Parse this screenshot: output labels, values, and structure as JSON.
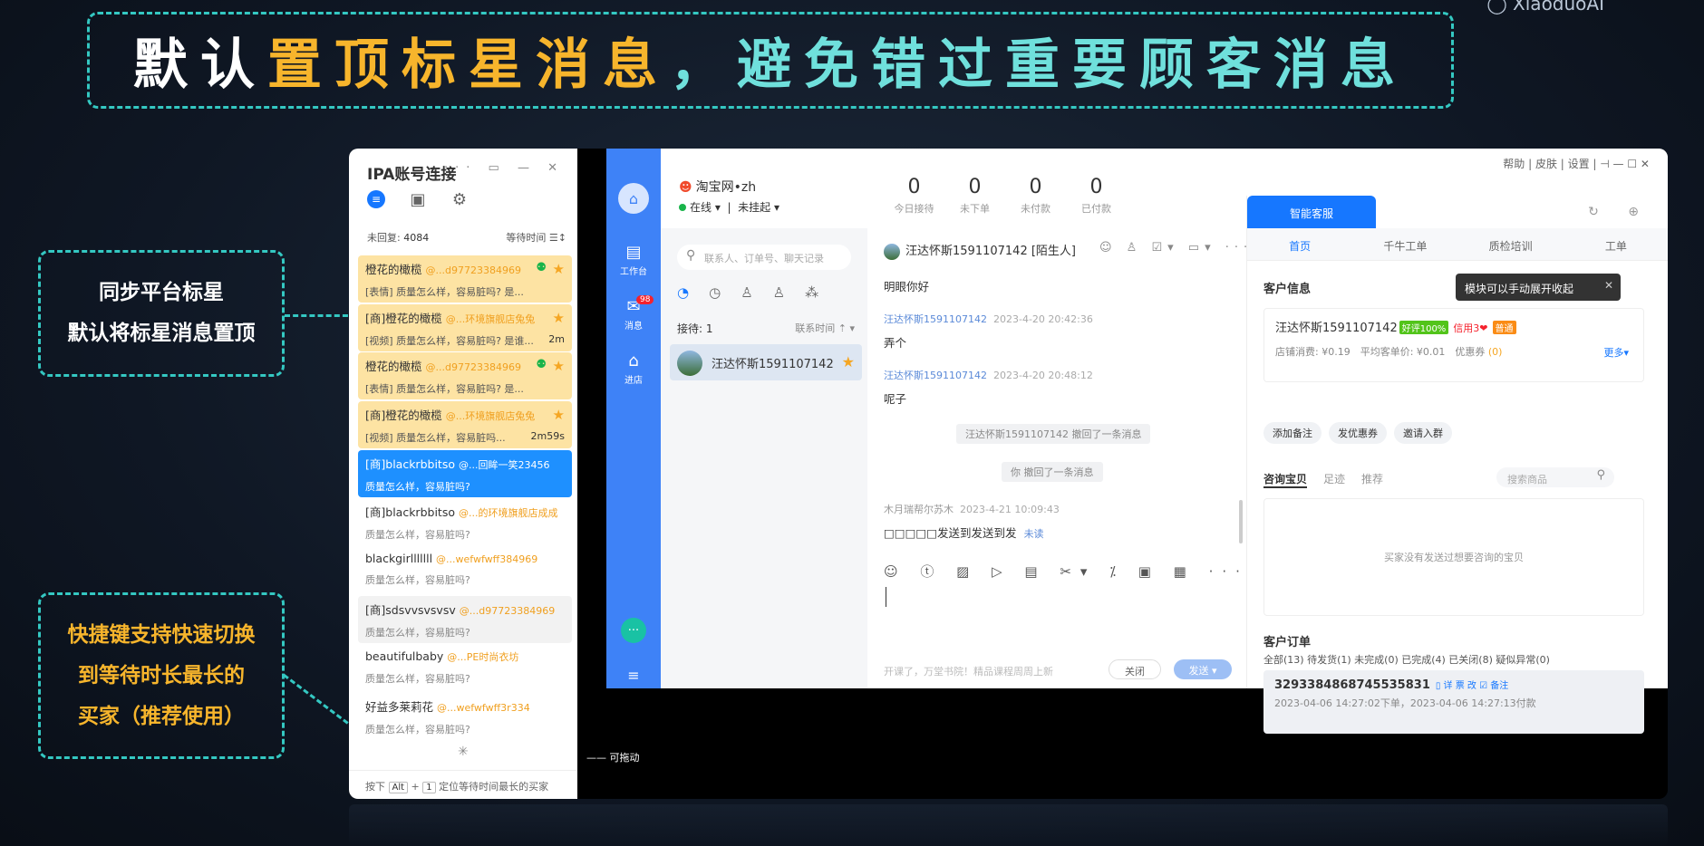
{
  "watermark": "◯ XiaoduoAI",
  "banner": {
    "part1": "默认",
    "part2": "置顶标星消息",
    "part3": "，避免错过重要顾客消息"
  },
  "callouts": {
    "c1_line1": "同步平台标星",
    "c1_line2": "默认将标星消息置顶",
    "c2_line1": "快捷键支持快速切换",
    "c2_line2": "到等待时长最长的",
    "c2_line3": "买家（推荐使用）"
  },
  "ipa": {
    "title": "IPA账号连接",
    "window_controls": "··· ▭ — ✕",
    "unreplied_label": "未回复:",
    "unreplied_count": "4084",
    "wait_label": "等待时间 ☰↕",
    "items": [
      {
        "name": "橙花的橄榄",
        "shop": "@...d97723384969",
        "msg": "[表情] 质量怎么样，容易脏吗? 是...",
        "time": ""
      },
      {
        "name": "[商]橙花的橄榄",
        "shop": "@...环境旗舰店兔兔",
        "msg": "[视频] 质量怎么样，容易脏吗? 是谁...",
        "time": "2m"
      },
      {
        "name": "橙花的橄榄",
        "shop": "@...d97723384969",
        "msg": "[表情] 质量怎么样，容易脏吗? 是...",
        "time": ""
      },
      {
        "name": "[商]橙花的橄榄",
        "shop": "@...环境旗舰店兔兔",
        "msg": "[视频] 质量怎么样，容易脏吗...",
        "time": "2m59s"
      },
      {
        "name": "[商]blackrbbitso",
        "shop": "@...回眸一笑23456",
        "msg": "质量怎么样，容易脏吗?",
        "time": ""
      },
      {
        "name": "[商]blackrbbitso",
        "shop": "@...的环境旗舰店成成",
        "msg": "质量怎么样，容易脏吗?",
        "time": ""
      },
      {
        "name": "blackgirlllllll",
        "shop": "@...wefwfwff384969",
        "msg": "质量怎么样，容易脏吗?",
        "time": ""
      },
      {
        "name": "[商]sdsvvsvsvsv",
        "shop": "@...d97723384969",
        "msg": "质量怎么样，容易脏吗?",
        "time": ""
      },
      {
        "name": "beautifulbaby",
        "shop": "@...PE时尚衣坊",
        "msg": "质量怎么样，容易脏吗?",
        "time": ""
      },
      {
        "name": "好益多莱莉花",
        "shop": "@...wefwfwff3r334",
        "msg": "质量怎么样，容易脏吗?",
        "time": ""
      }
    ],
    "hint_pre": "按下",
    "key1": "Alt",
    "plus": "+",
    "key2": "1",
    "hint_post": "定位等待时间最长的买家"
  },
  "qn": {
    "rail": {
      "workbench": "工作台",
      "messages": "消息",
      "badge": "98",
      "store": "进店"
    },
    "shop": {
      "name": "淘宝网•zh",
      "online": "在线 ▾",
      "hang": "未挂起 ▾"
    },
    "kpis": [
      {
        "v": "0",
        "l": "今日接待"
      },
      {
        "v": "0",
        "l": "未下单"
      },
      {
        "v": "0",
        "l": "未付款"
      },
      {
        "v": "0",
        "l": "已付款"
      }
    ],
    "topright": "帮助 | 皮肤 | 设置 | ⊣ — ☐ ✕",
    "search_placeholder": "联系人、订单号、聊天记录",
    "reception_label": "接待: 1",
    "sort_label": "联系时间 ⇡ ▾",
    "contact_name": "汪达怀斯1591107142",
    "chat_title": "汪达怀斯1591107142 [陌生人]",
    "chat_tools": "☺ ♙ ☑▾ ▭▾ ···",
    "m1": "明眼你好",
    "m2_sender": "汪达怀斯1591107142",
    "m2_time": "2023-4-20 20:42:36",
    "m2": "弄个",
    "m3_sender": "汪达怀斯1591107142",
    "m3_time": "2023-4-20 20:48:12",
    "m3": "呢子",
    "sys1": "汪达怀斯1591107142 撤回了一条消息",
    "sys2": "你 撤回了一条消息",
    "m4_sender": "木月瑞帮尔苏木",
    "m4_time": "2023-4-21 10:09:43",
    "m4": "□□□□□发送到发送到发",
    "unread": "未读",
    "editor_tools": "☺ ⓣ ▨ ▷ ▤ ✂▾ ⁒ ▣ ▦ ···",
    "editor_tools_right": "⇨ ⊙▾",
    "footer_tip": "开课了，万堂书院！精品课程周周上新",
    "close_btn": "关闭",
    "send_btn": "发送 ▾",
    "drag": "—— 可拖动"
  },
  "side": {
    "smart_tab": "智能客服",
    "tabs": [
      "首页",
      "千牛工单",
      "质检培训",
      "工单"
    ],
    "cust_info": "客户信息",
    "tooltip": "模块可以手动展开收起",
    "cust_name": "汪达怀斯1591107142",
    "tag_good": "好评100%",
    "credit": "信用3❤",
    "tag_normal": "普通",
    "cust_meta": "店铺消费: ¥0.19　平均客单价: ¥0.01　优惠券",
    "coupon": "(0)",
    "more": "更多▾",
    "chips": [
      "添加备注",
      "发优惠券",
      "邀请入群"
    ],
    "sub_tabs": [
      "咨询宝贝",
      "足迹",
      "推荐"
    ],
    "prod_search": "搜索商品",
    "empty": "买家没有发送过想要咨询的宝贝",
    "orders_title": "客户订单",
    "order_tabs": "全部(13)  待发货(1)  未完成(0)  已完成(4)  已关闭(8)  疑似异常(0)",
    "order_no": "3293384868745535831",
    "order_btns": "▯ 详 票 改 ☑ 备注",
    "order_time": "2023-04-06 14:27:02下单，2023-04-06 14:27:13付款"
  }
}
